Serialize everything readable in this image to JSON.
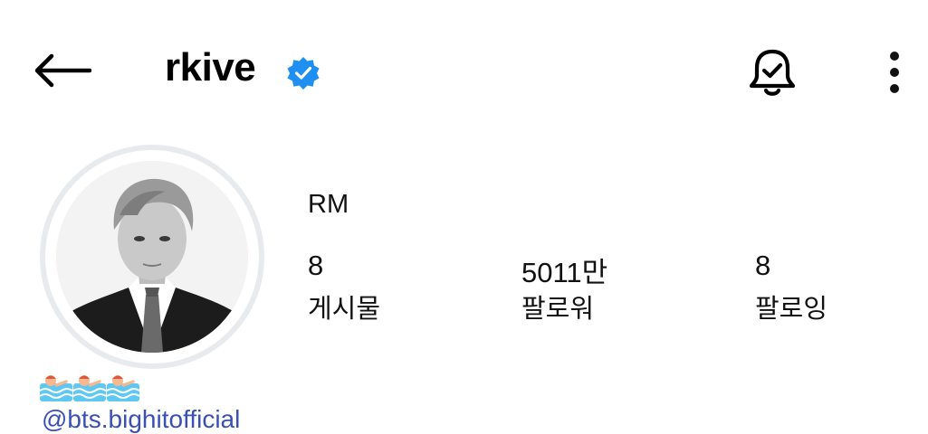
{
  "header": {
    "username": "rkive",
    "back_icon": "arrow-left-icon",
    "verified_icon": "verified-badge-icon",
    "notifications_icon": "bell-check-icon",
    "more_icon": "more-vertical-icon",
    "verified_color": "#1f8ff2"
  },
  "profile": {
    "display_name": "RM",
    "stats": {
      "posts": {
        "value": "8",
        "label": "게시물"
      },
      "followers": {
        "value": "5011만",
        "label": "팔로워"
      },
      "following": {
        "value": "8",
        "label": "팔로잉"
      }
    }
  },
  "bio": {
    "emoji": "🏊🏊🏊",
    "link": "@bts.bighitofficial"
  },
  "colors": {
    "link": "#3a50b5",
    "avatar_ring": "#e8ebee"
  }
}
